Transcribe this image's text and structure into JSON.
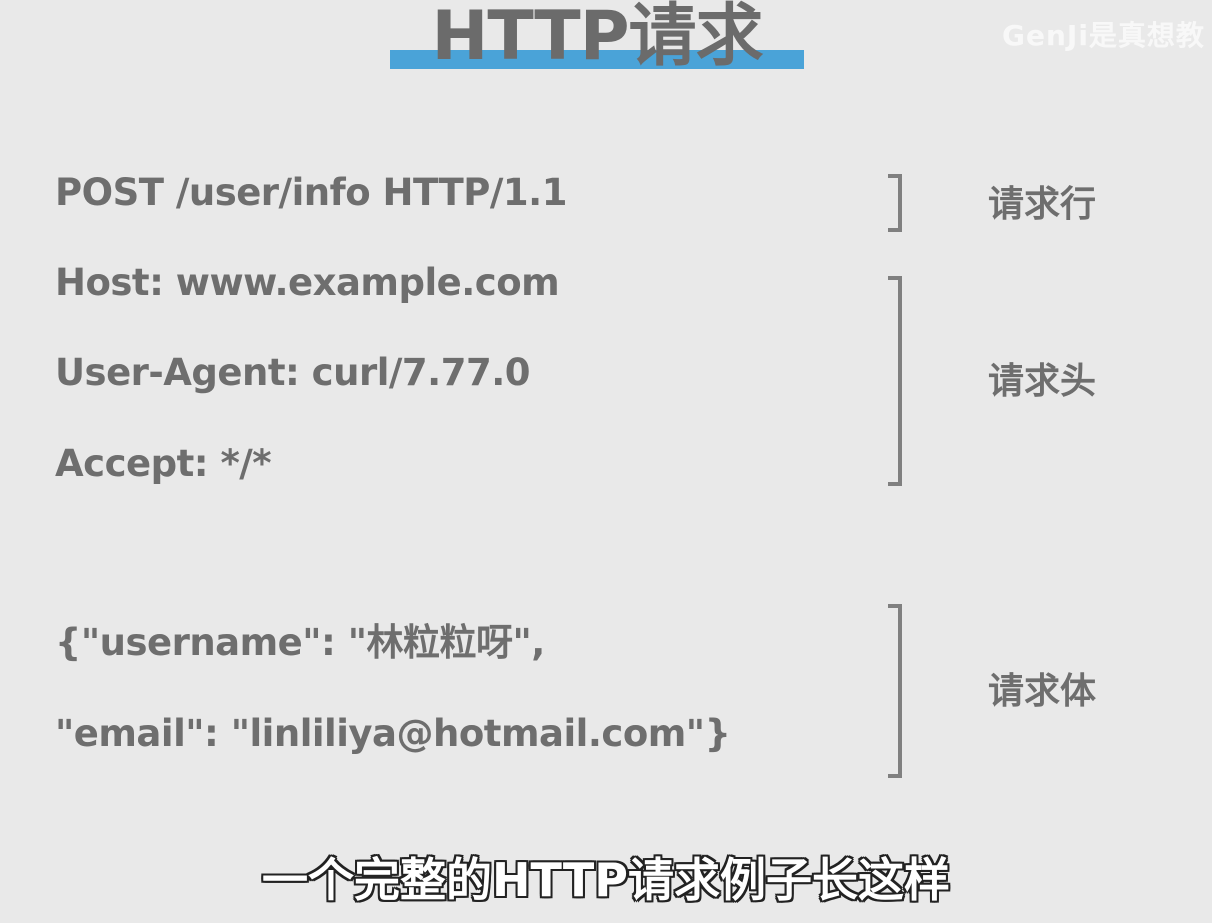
{
  "header": {
    "title": "HTTP请求",
    "watermark": "GenJi是真想教"
  },
  "request": {
    "request_line": "POST /user/info HTTP/1.1",
    "headers": [
      "Host: www.example.com",
      "User-Agent: curl/7.77.0",
      "Accept: */*"
    ],
    "body": [
      "{\"username\": \"林粒粒呀\",",
      "\"email\": \"linliliya@hotmail.com\"}"
    ]
  },
  "sections": {
    "request_line_label": "请求行",
    "headers_label": "请求头",
    "body_label": "请求体"
  },
  "subtitle": "一个完整的HTTP请求例子长这样",
  "colors": {
    "background": "#e9e9e9",
    "accent_underline": "#4aa3d8",
    "text": "#6e6e6e",
    "bracket": "#808080"
  }
}
